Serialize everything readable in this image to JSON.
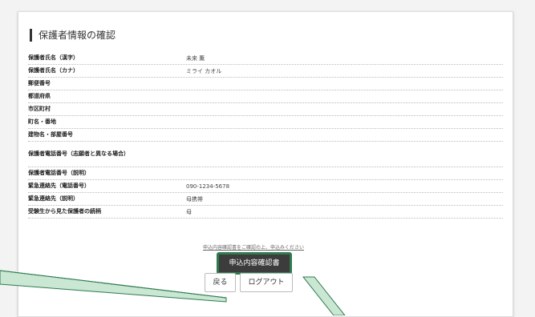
{
  "section": {
    "title": "保護者情報の確認"
  },
  "rows": [
    {
      "label": "保護者氏名（漢字）",
      "value": "未来 薫"
    },
    {
      "label": "保護者氏名（カナ）",
      "value": "ミライ カオル"
    },
    {
      "label": "郵便番号",
      "value": ""
    },
    {
      "label": "都道府県",
      "value": ""
    },
    {
      "label": "市区町村",
      "value": ""
    },
    {
      "label": "町名・番地",
      "value": ""
    },
    {
      "label": "建物名・部屋番号",
      "value": ""
    },
    {
      "label": "保護者電話番号（志願者と異なる場合）",
      "value": ""
    },
    {
      "label": "保護者電話番号（説明）",
      "value": ""
    },
    {
      "label": "緊急連絡先（電話番号）",
      "value": "090-1234-5678"
    },
    {
      "label": "緊急連絡先（説明）",
      "value": "母携帯"
    },
    {
      "label": "受験生から見た保護者の続柄",
      "value": "母"
    }
  ],
  "actions": {
    "note": "申込内容確認書をご確認の上、申込みください",
    "print_label": "申込内容確認書",
    "back_label": "戻る",
    "logout_label": "ログアウト"
  },
  "colors": {
    "highlight": "#2f7a4f",
    "callout": "#c9e7d3"
  }
}
